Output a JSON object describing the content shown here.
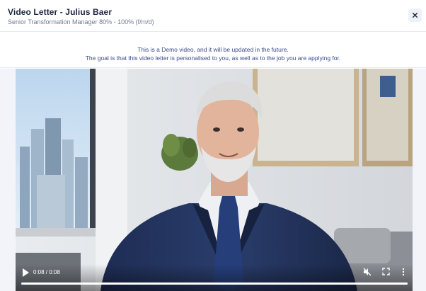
{
  "header": {
    "title": "Video Letter - Julius Baer",
    "subtitle": "Senior Transformation Manager 80% - 100% (f/m/d)",
    "close_icon": "close-icon"
  },
  "notice": {
    "line1": "This is a Demo video, and it will be updated in the future.",
    "line2": "The goal is that this video letter is personalised to you, as well as to the job you are applying for."
  },
  "video": {
    "time": "0:08 / 0:08",
    "progress": 1.0,
    "icons": [
      "play-icon",
      "muted-icon",
      "fullscreen-icon",
      "more-vert-icon"
    ]
  },
  "colors": {
    "title": "#1c2540",
    "subtitle": "#6f7a93",
    "notice_text": "#3a4a8c",
    "side_panel": "#f2f4f9"
  }
}
